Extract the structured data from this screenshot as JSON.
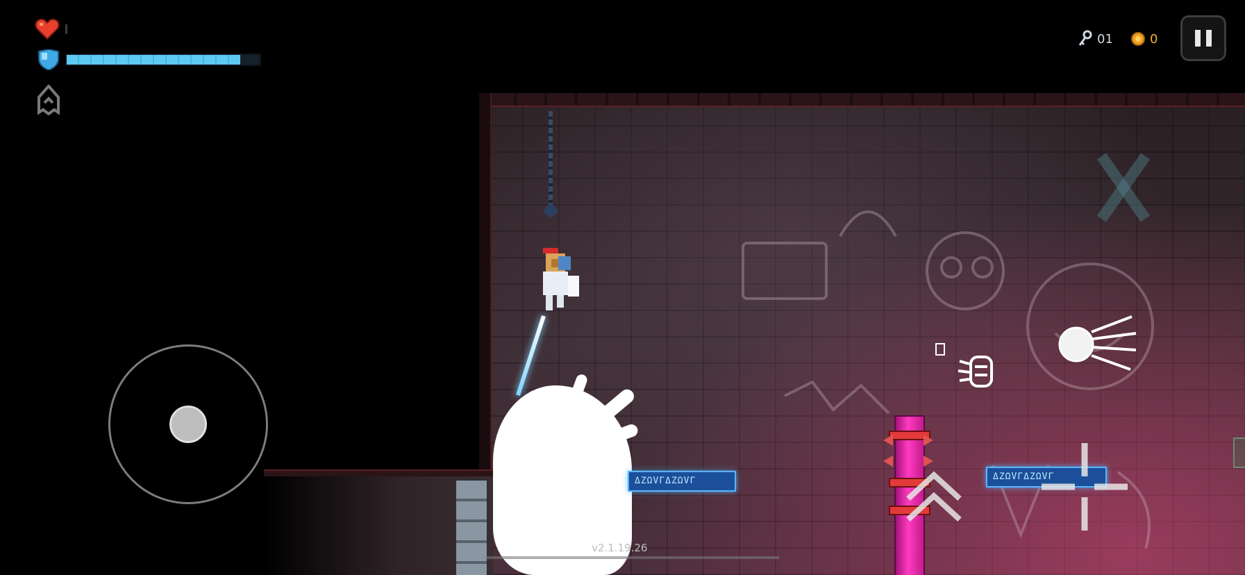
{
  "hud": {
    "keys": {
      "icon": "key-icon",
      "count": "01"
    },
    "coins": {
      "icon": "coin-icon",
      "count": "0"
    },
    "health": {
      "icon": "heart-icon",
      "color": "#e8402c"
    },
    "shield": {
      "icon": "shield-icon",
      "color": "#5ec9f2",
      "level": 0.9
    },
    "skill": {
      "icon": "hooded-figure-icon"
    },
    "pause": {
      "icon": "pause-icon"
    }
  },
  "controls": {
    "joystick": {
      "icon": "virtual-joystick"
    },
    "dash": {
      "icon": "dash-icon"
    },
    "weapon": {
      "icon": "weapon-orb-icon"
    },
    "jump": {
      "icon": "double-chevron-up-icon"
    },
    "aim": {
      "icon": "crosshair-icon"
    }
  },
  "world": {
    "rune_sign_left": "ΔΖΩVΓΔΖΩVΓ",
    "rune_sign_right": "ΔΖΩVΓΔΖΩVΓ",
    "accent_pink": "#ff3bbf",
    "accent_blue": "#58b6ff"
  },
  "footer": {
    "version": "v2.1.19.26"
  }
}
